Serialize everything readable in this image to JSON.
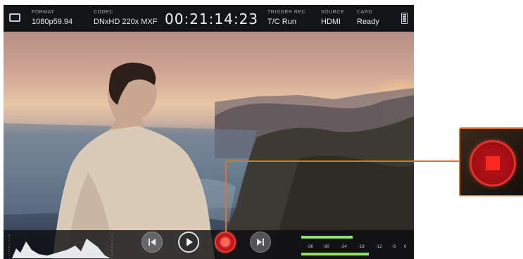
{
  "status_bar": {
    "format": {
      "label": "FORMAT",
      "value": "1080p59.94"
    },
    "codec": {
      "label": "CODEC",
      "value": "DNxHD 220x MXF"
    },
    "timecode": "00:21:14:23",
    "trigger_rec": {
      "label": "TRIGGER REC",
      "value": "T/C Run"
    },
    "source": {
      "label": "SOURCE",
      "value": "HDMI"
    },
    "card": {
      "label": "CARD",
      "value": "Ready"
    },
    "icons": [
      "monitor-icon",
      "battery-icon"
    ]
  },
  "transport": {
    "buttons": [
      "skip-back",
      "play",
      "record",
      "skip-forward"
    ],
    "record_state": "recording"
  },
  "audio_meters": {
    "scale": [
      "-36",
      "-30",
      "-24",
      "-18",
      "-12",
      "-6",
      "0"
    ],
    "channels": [
      {
        "name": "ch1",
        "level_fraction": 0.48
      },
      {
        "name": "ch2",
        "level_fraction": 0.63
      }
    ]
  },
  "callout": {
    "target": "record-button",
    "zoom_icon": "stop-icon",
    "accent_color": "#e0702a"
  },
  "colors": {
    "record_red": "#c8151a",
    "meter_green": "#8ee36a",
    "status_bar_bg": "#121417"
  }
}
